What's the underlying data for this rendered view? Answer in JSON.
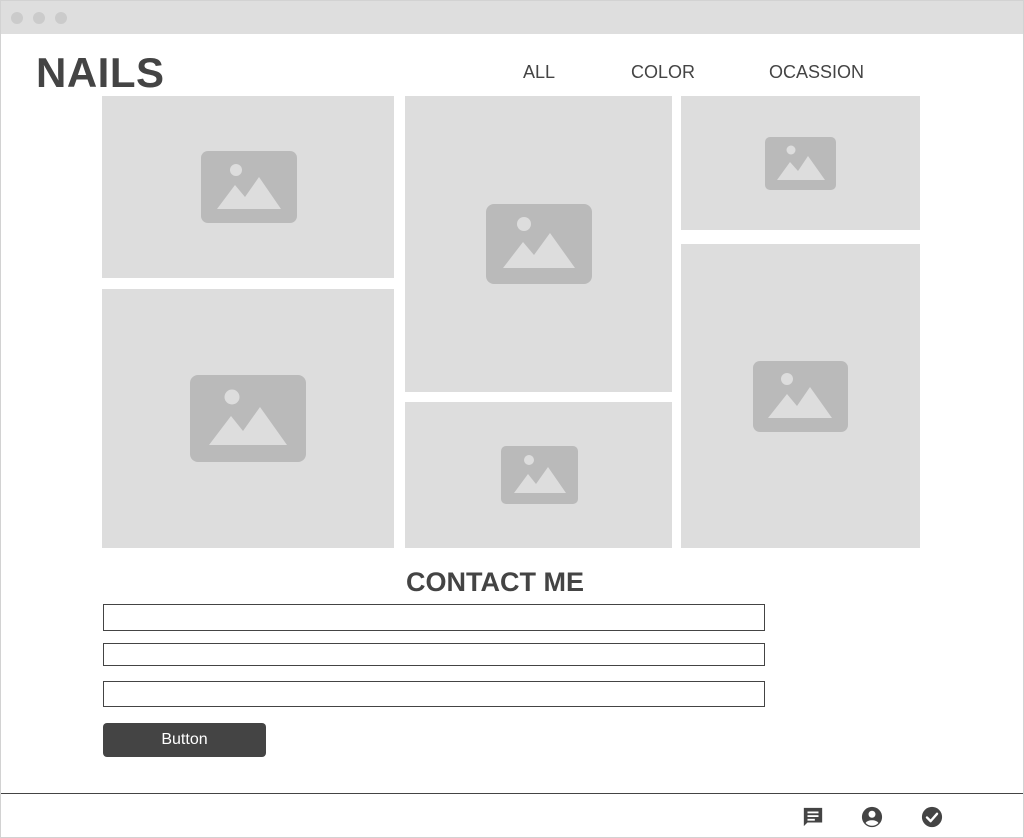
{
  "brand": {
    "logo": "NAILS"
  },
  "nav": {
    "items": [
      {
        "label": "ALL"
      },
      {
        "label": "COLOR"
      },
      {
        "label": "OCASSION"
      }
    ]
  },
  "gallery": {
    "tiles": [
      {
        "icon": "image-placeholder-icon"
      },
      {
        "icon": "image-placeholder-icon"
      },
      {
        "icon": "image-placeholder-icon"
      },
      {
        "icon": "image-placeholder-icon"
      },
      {
        "icon": "image-placeholder-icon"
      },
      {
        "icon": "image-placeholder-icon"
      }
    ]
  },
  "contact": {
    "title": "CONTACT ME",
    "fields": [
      {
        "value": "",
        "placeholder": ""
      },
      {
        "value": "",
        "placeholder": ""
      },
      {
        "value": "",
        "placeholder": ""
      }
    ],
    "button_label": "Button"
  },
  "footer": {
    "icons": [
      "chat-icon",
      "account-icon",
      "check-circle-icon"
    ]
  },
  "colors": {
    "placeholder_bg": "#dddddd",
    "placeholder_icon": "#bababa",
    "text": "#444444",
    "button_bg": "#444444",
    "button_text": "#ffffff"
  }
}
